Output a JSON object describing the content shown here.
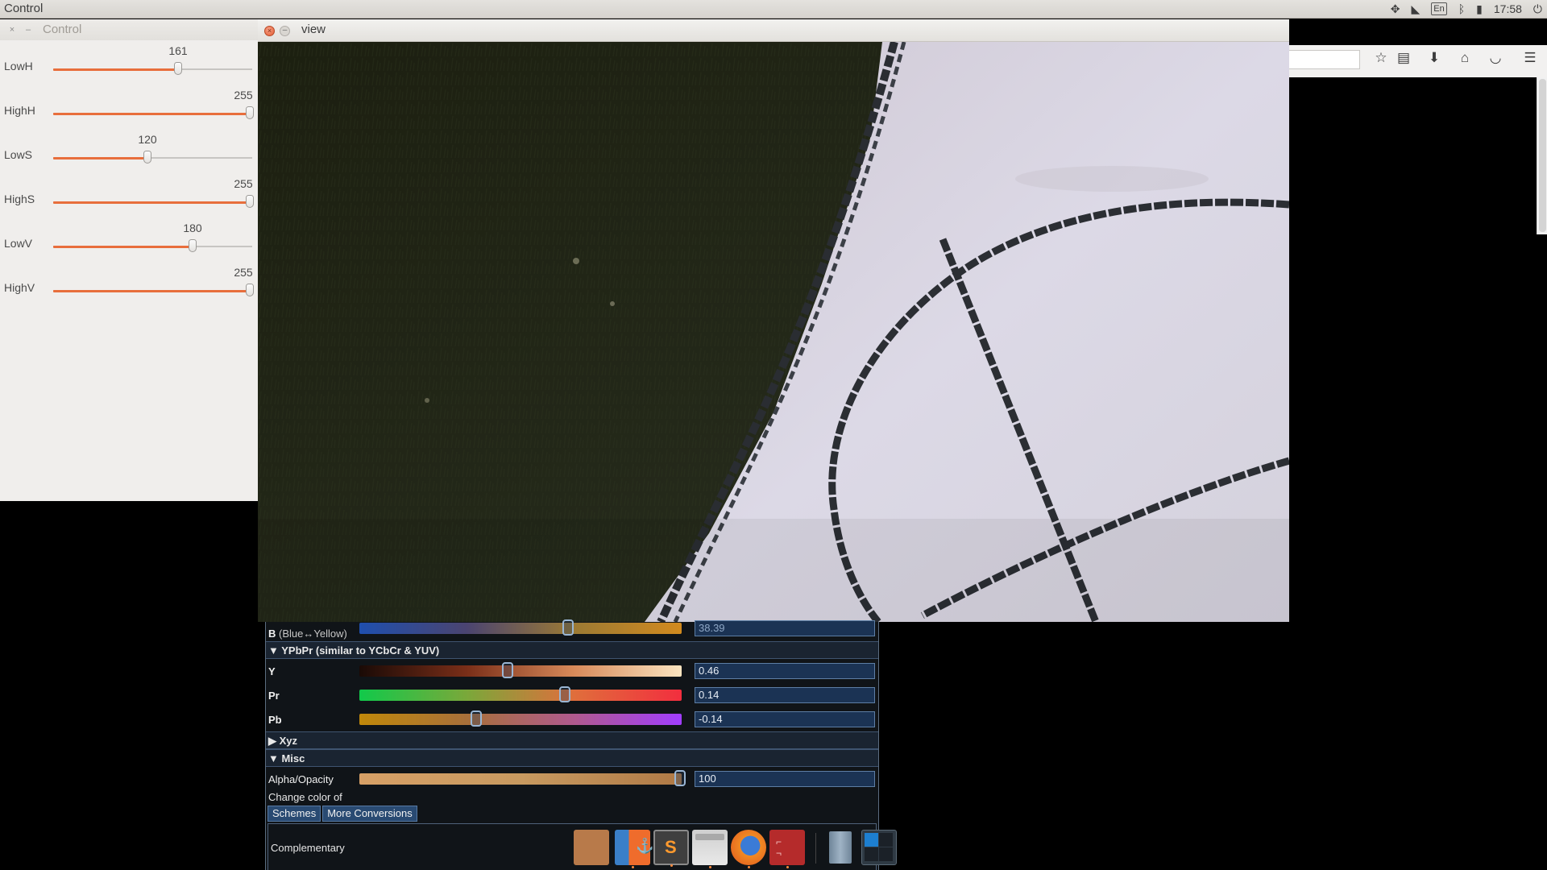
{
  "topbar": {
    "app_title": "Control",
    "keyboard_layout": "En",
    "clock": "17:58",
    "tray_icons": [
      "dropbox-icon",
      "wifi-icon",
      "keyboard-icon",
      "bluetooth-icon",
      "battery-icon",
      "power-icon"
    ]
  },
  "control": {
    "title": "Control",
    "sliders": [
      {
        "label": "LowH",
        "value": "161",
        "fraction": 0.631
      },
      {
        "label": "HighH",
        "value": "255",
        "fraction": 1.0
      },
      {
        "label": "LowS",
        "value": "120",
        "fraction": 0.471
      },
      {
        "label": "HighS",
        "value": "255",
        "fraction": 1.0
      },
      {
        "label": "LowV",
        "value": "180",
        "fraction": 0.706
      },
      {
        "label": "HighV",
        "value": "255",
        "fraction": 1.0
      }
    ]
  },
  "view": {
    "title": "view"
  },
  "browser": {
    "toolbar_icons": [
      "star-icon",
      "reading-list-icon",
      "download-icon",
      "home-icon",
      "pocket-icon",
      "menu-icon"
    ]
  },
  "colorpanel": {
    "b_row": {
      "label": "B",
      "sub": "(Blue↔Yellow)",
      "value": "38.39",
      "fraction": 0.65
    },
    "ypbpr_section": "▼ YPbPr (similar to YCbCr & YUV)",
    "ypbpr_rows": [
      {
        "label": "Y",
        "value": "0.46",
        "fraction": 0.46
      },
      {
        "label": "Pr",
        "value": "0.14",
        "fraction": 0.64
      },
      {
        "label": "Pb",
        "value": "-0.14",
        "fraction": 0.36
      }
    ],
    "xyz_section": "▶ Xyz",
    "misc_section": "▼ Misc",
    "alpha_row": {
      "label": "Alpha/Opacity",
      "value": "100",
      "fraction": 1.0
    },
    "change_color_label": "Change color of",
    "tabs": [
      "Schemes",
      "More Conversions"
    ],
    "scheme_label": "Complementary",
    "accent_colors": {
      "section_bg": "#1a2431",
      "value_box_bg": "#1b3354",
      "tab_bg": "#294a72"
    }
  },
  "dock": {
    "items": [
      {
        "name": "swatch-icon",
        "color": "#b87a4a"
      },
      {
        "name": "anchor-app-icon",
        "color": "#ef6c2c"
      },
      {
        "name": "sublime-text-icon",
        "color": "#4a4a4a"
      },
      {
        "name": "files-icon",
        "color": "#d9d9d9"
      },
      {
        "name": "firefox-icon",
        "color": "#f08a24"
      },
      {
        "name": "red-app-icon",
        "color": "#b52b2b"
      },
      {
        "name": "trash-icon",
        "color": "#7d93a8"
      },
      {
        "name": "workspace-switcher-icon",
        "color": "#2f3a44"
      }
    ]
  }
}
